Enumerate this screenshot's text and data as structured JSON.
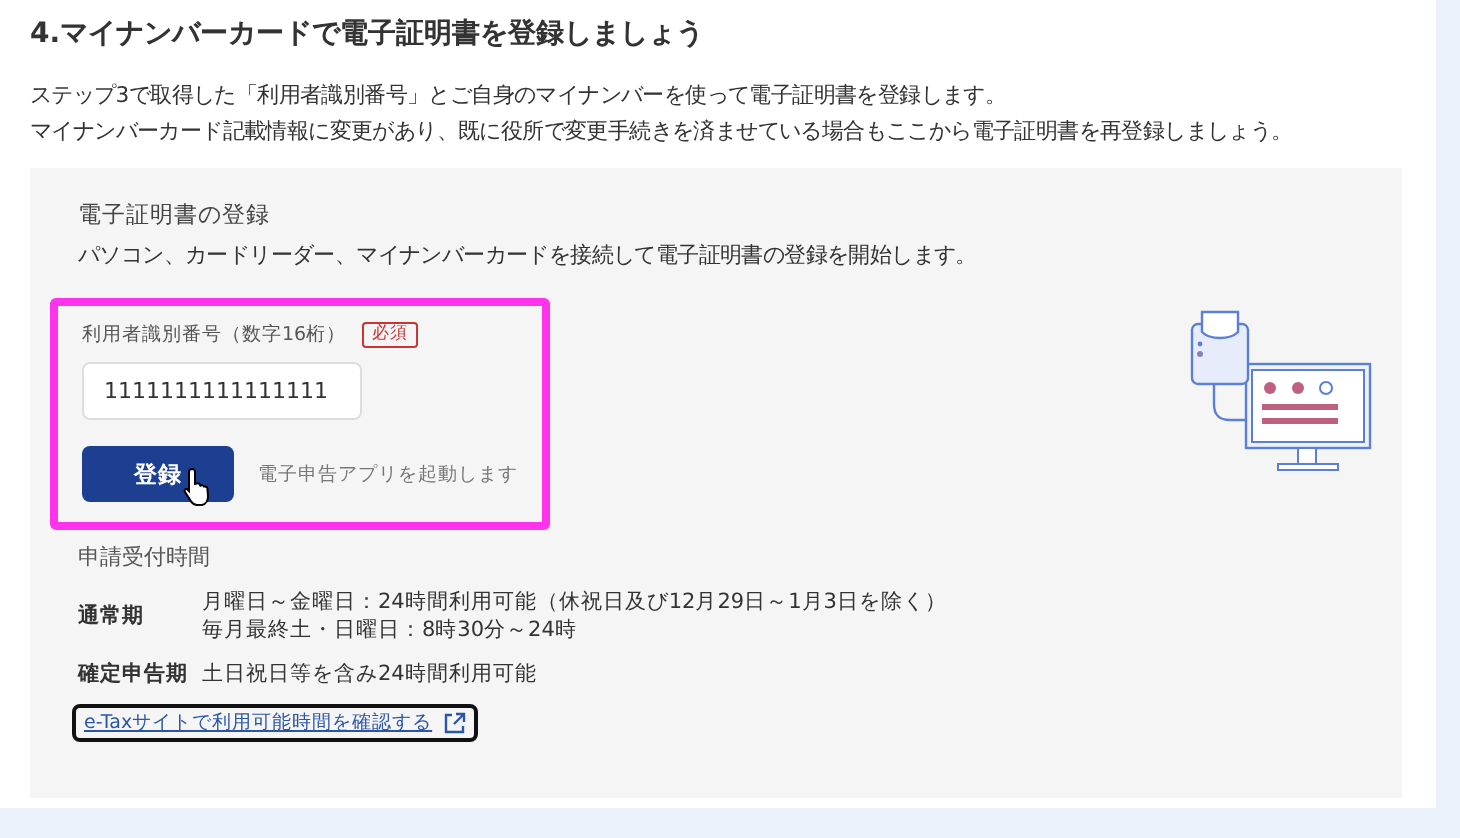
{
  "section_title": "4.マイナンバーカードで電子証明書を登録しましょう",
  "intro": [
    "ステップ3で取得した「利用者識別番号」とご自身のマイナンバーを使って電子証明書を登録します。",
    "マイナンバーカード記載情報に変更があり、既に役所で変更手続きを済ませている場合もここから電子証明書を再登録しましょう。"
  ],
  "panel": {
    "heading": "電子証明書の登録",
    "description": "パソコン、カードリーダー、マイナンバーカードを接続して電子証明書の登録を開始します。",
    "field": {
      "label": "利用者識別番号（数字16桁）",
      "required_badge": "必須",
      "value": "1111111111111111"
    },
    "button": "登録",
    "button_note": "電子申告アプリを起動します",
    "hours": {
      "heading": "申請受付時間",
      "rows": [
        {
          "term": "通常期",
          "lines": [
            "月曜日～金曜日：24時間利用可能（休祝日及び12月29日～1月3日を除く）",
            "毎月最終土・日曜日：8時30分～24時"
          ]
        },
        {
          "term": "確定申告期",
          "lines": [
            "土日祝日等を含み24時間利用可能"
          ]
        }
      ]
    },
    "link": "e-Taxサイトで利用可能時間を確認する"
  }
}
